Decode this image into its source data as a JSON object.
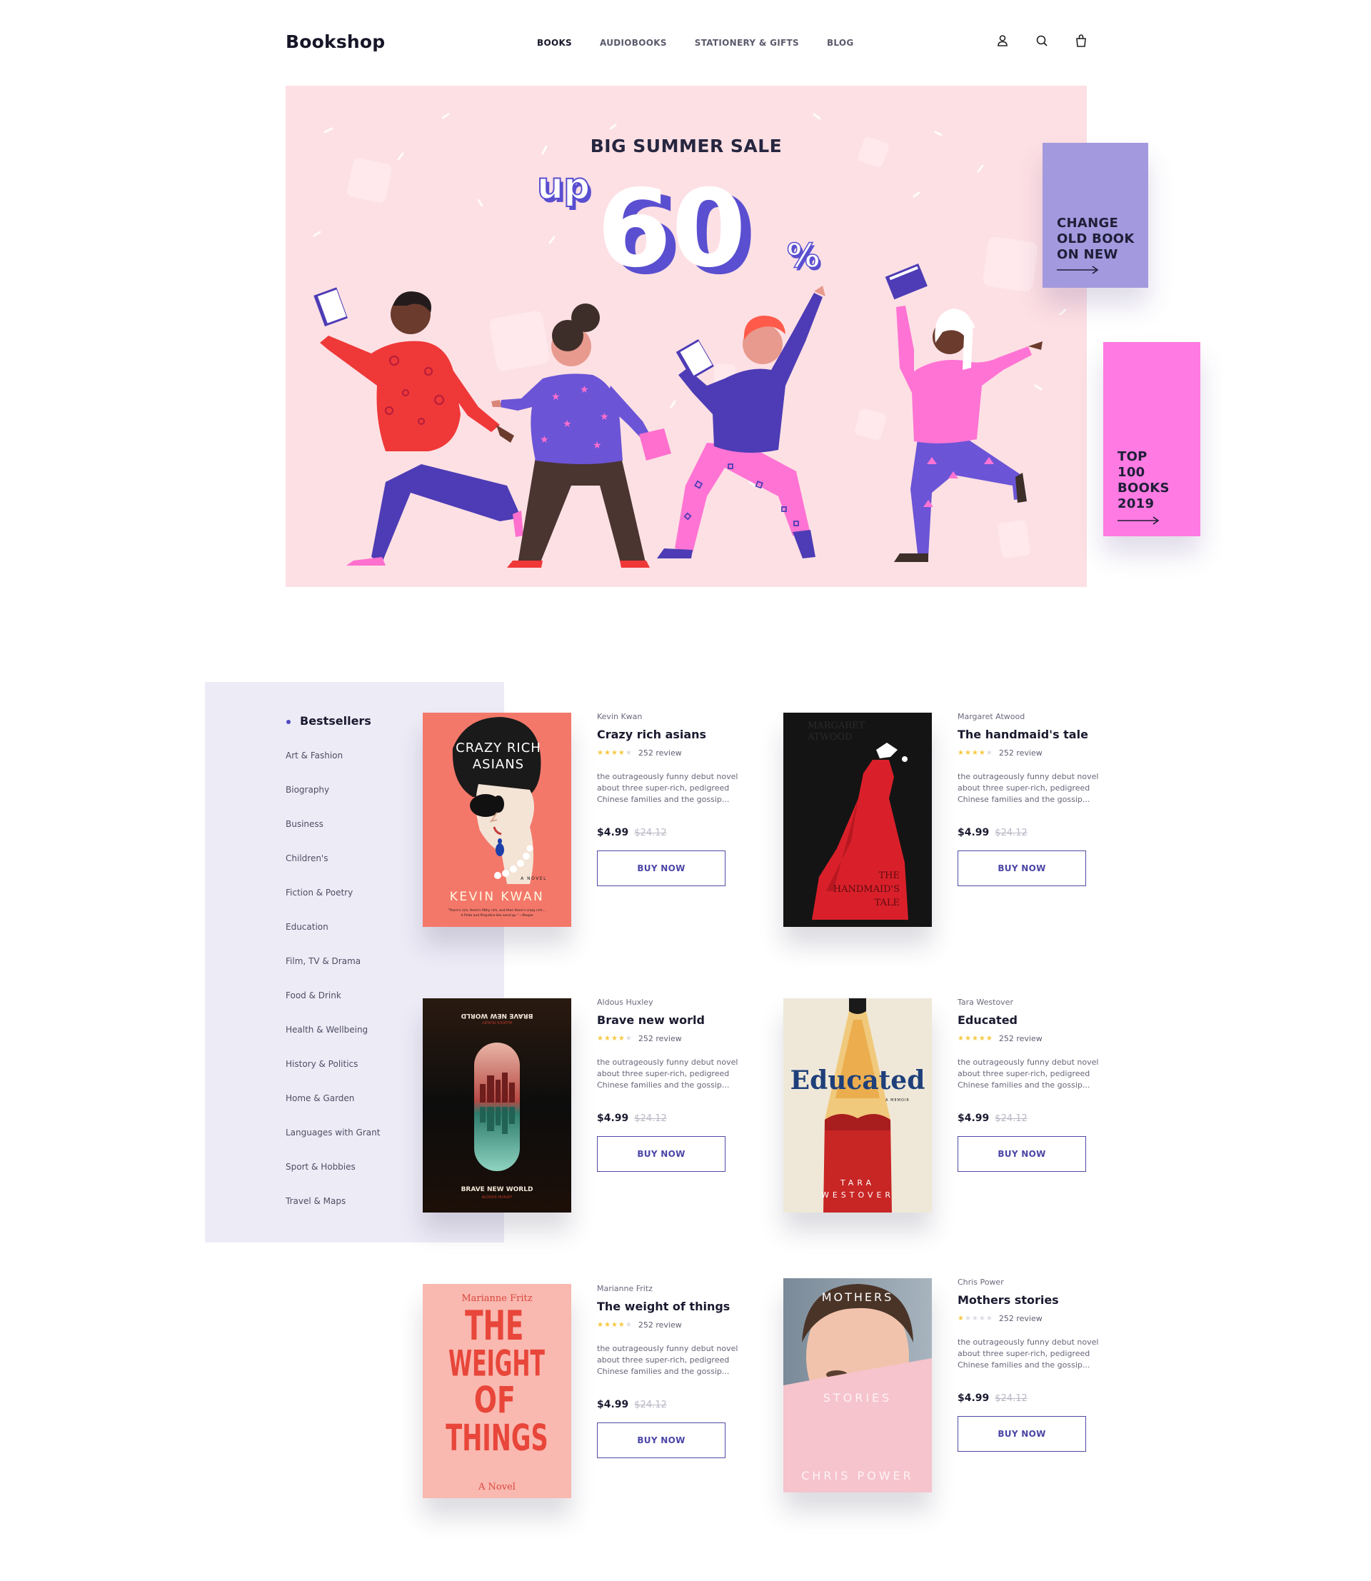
{
  "header": {
    "logo": "Bookshop",
    "nav": [
      "BOOKS",
      "AUDIOBOOKS",
      "STATIONERY & GIFTS",
      "BLOG"
    ]
  },
  "hero": {
    "title": "BIG SUMMER SALE",
    "up": "up",
    "amount": "60",
    "percent": "%"
  },
  "promos": [
    {
      "lines": [
        "CHANGE",
        "OLD BOOK",
        "ON NEW"
      ]
    },
    {
      "lines": [
        "TOP",
        "100",
        "BOOKS",
        "2019"
      ]
    }
  ],
  "sidebar": {
    "active": "Bestsellers",
    "categories": [
      "Art & Fashion",
      "Biography",
      "Business",
      "Children's",
      "Fiction & Poetry",
      "Education",
      "Film, TV & Drama",
      "Food & Drink",
      "Health & Wellbeing",
      "History & Politics",
      "Home & Garden",
      "Languages with Grant",
      "Sport & Hobbies",
      "Travel & Maps"
    ]
  },
  "products": [
    {
      "author": "Kevin Kwan",
      "title": "Crazy rich asians",
      "rating": 4,
      "reviews": "252 review",
      "description": "the outrageously funny debut novel about three super-rich, pedigreed Chinese families and the gossip...",
      "price": "$4.99",
      "old_price": "$24.12",
      "button": "BUY NOW",
      "cover": {
        "title_lines": [
          "CRAZY RICH",
          "ASIANS"
        ],
        "tagline": "A NOVEL",
        "author": "KEVIN KWAN",
        "quote_lines": [
          "\"There's rich, there's filthy rich, and then there's crazy rich....",
          "A Pride and Prejudice-like send-up.\" —People"
        ]
      }
    },
    {
      "author": "Margaret Atwood",
      "title": "The handmaid's tale",
      "rating": 4,
      "reviews": "252 review",
      "description": "the outrageously funny debut novel about three super-rich, pedigreed Chinese families and the gossip...",
      "price": "$4.99",
      "old_price": "$24.12",
      "button": "BUY NOW",
      "cover": {
        "author_lines": [
          "MARGARET",
          "ATWOOD"
        ],
        "title_lines": [
          "THE",
          "HANDMAID'S",
          "TALE"
        ]
      }
    },
    {
      "author": "Aldous Huxley",
      "title": "Brave new world",
      "rating": 4,
      "reviews": "252 review",
      "description": "the outrageously funny debut novel about three super-rich, pedigreed Chinese families and the gossip...",
      "price": "$4.99",
      "old_price": "$24.12",
      "button": "BUY NOW",
      "cover": {
        "title": "BRAVE NEW WORLD",
        "author": "ALDOUS HUXLEY"
      }
    },
    {
      "author": "Tara Westover",
      "title": "Educated",
      "rating": 5,
      "reviews": "252 review",
      "description": "the outrageously funny debut novel about three super-rich, pedigreed Chinese families and the gossip...",
      "price": "$4.99",
      "old_price": "$24.12",
      "button": "BUY NOW",
      "cover": {
        "title": "Educated",
        "subtitle": "A MEMOIR",
        "author_lines": [
          "TARA",
          "WESTOVER"
        ]
      }
    },
    {
      "author": "Marianne Fritz",
      "title": "The weight of things",
      "rating": 4,
      "reviews": "252 review",
      "description": "the outrageously funny debut novel about three super-rich, pedigreed Chinese families and the gossip...",
      "price": "$4.99",
      "old_price": "$24.12",
      "button": "BUY NOW",
      "cover": {
        "author": "Marianne Fritz",
        "title_lines": [
          "THE",
          "WEIGHT",
          "OF",
          "THINGS"
        ],
        "subtitle": "A Novel"
      }
    },
    {
      "author": "Chris Power",
      "title": "Mothers stories",
      "rating": 1,
      "reviews": "252 review",
      "description": "the outrageously funny debut novel about three super-rich, pedigreed Chinese families and the gossip...",
      "price": "$4.99",
      "old_price": "$24.12",
      "button": "BUY NOW",
      "cover": {
        "title": "MOTHERS",
        "subtitle": "STORIES",
        "author": "CHRIS POWER"
      }
    }
  ]
}
